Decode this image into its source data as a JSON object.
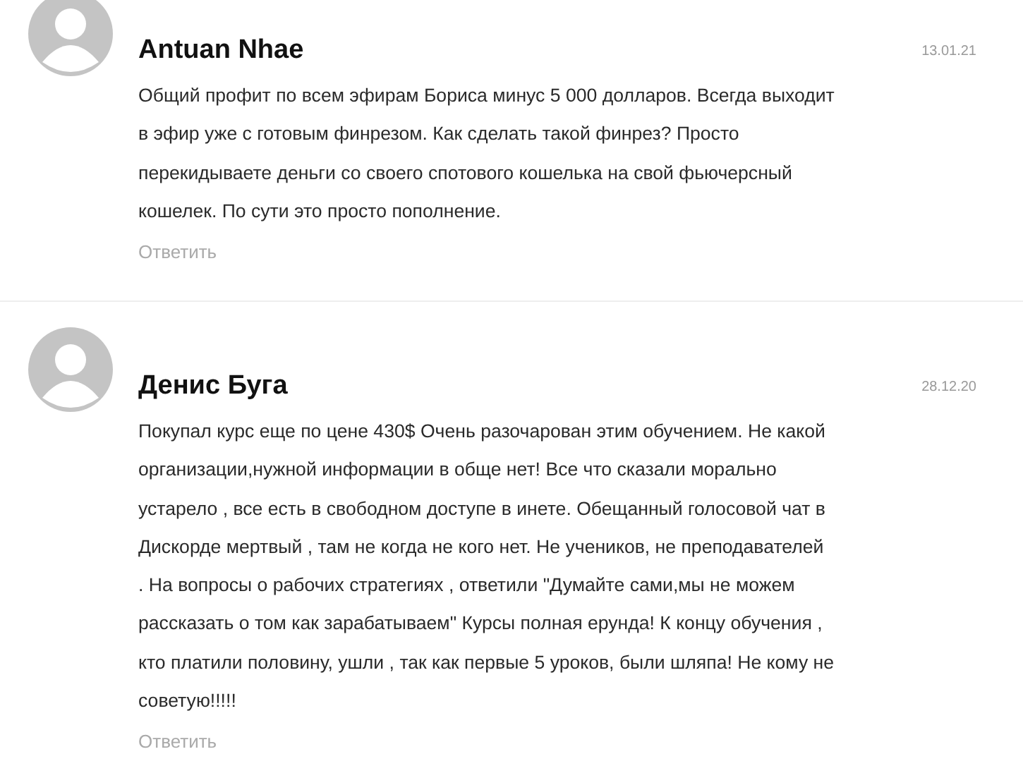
{
  "comments": [
    {
      "author": "Antuan Nhae",
      "date": "13.01.21",
      "lines": [
        "Общий профит по всем эфирам Бориса минус 5 000 долларов. Всегда выходит",
        "в эфир уже с готовым финрезом. Как сделать такой финрез? Просто",
        "перекидываете деньги со своего спотового кошелька на свой фьючерсный",
        "кошелек. По сути это просто пополнение."
      ],
      "reply": "Ответить"
    },
    {
      "author": "Денис Буга",
      "date": "28.12.20",
      "lines": [
        "Покупал курс еще по цене 430$ Очень разочарован этим обучением. Не какой",
        "организации,нужной информации в обще нет! Все что сказали морально",
        "устарело , все есть в свободном доступе в инете. Обещанный голосовой чат в",
        "Дискорде мертвый , там не когда не кого нет. Не учеников, не преподавателей",
        ". На вопросы о рабочих стратегиях , ответили \"Думайте сами,мы не можем",
        "рассказать о том как зарабатываем\" Курсы полная ерунда! К концу обучения ,",
        "кто платили половину, ушли , так как первые 5 уроков, были шляпа! Не кому не",
        "советую!!!!!"
      ],
      "reply": "Ответить"
    }
  ]
}
